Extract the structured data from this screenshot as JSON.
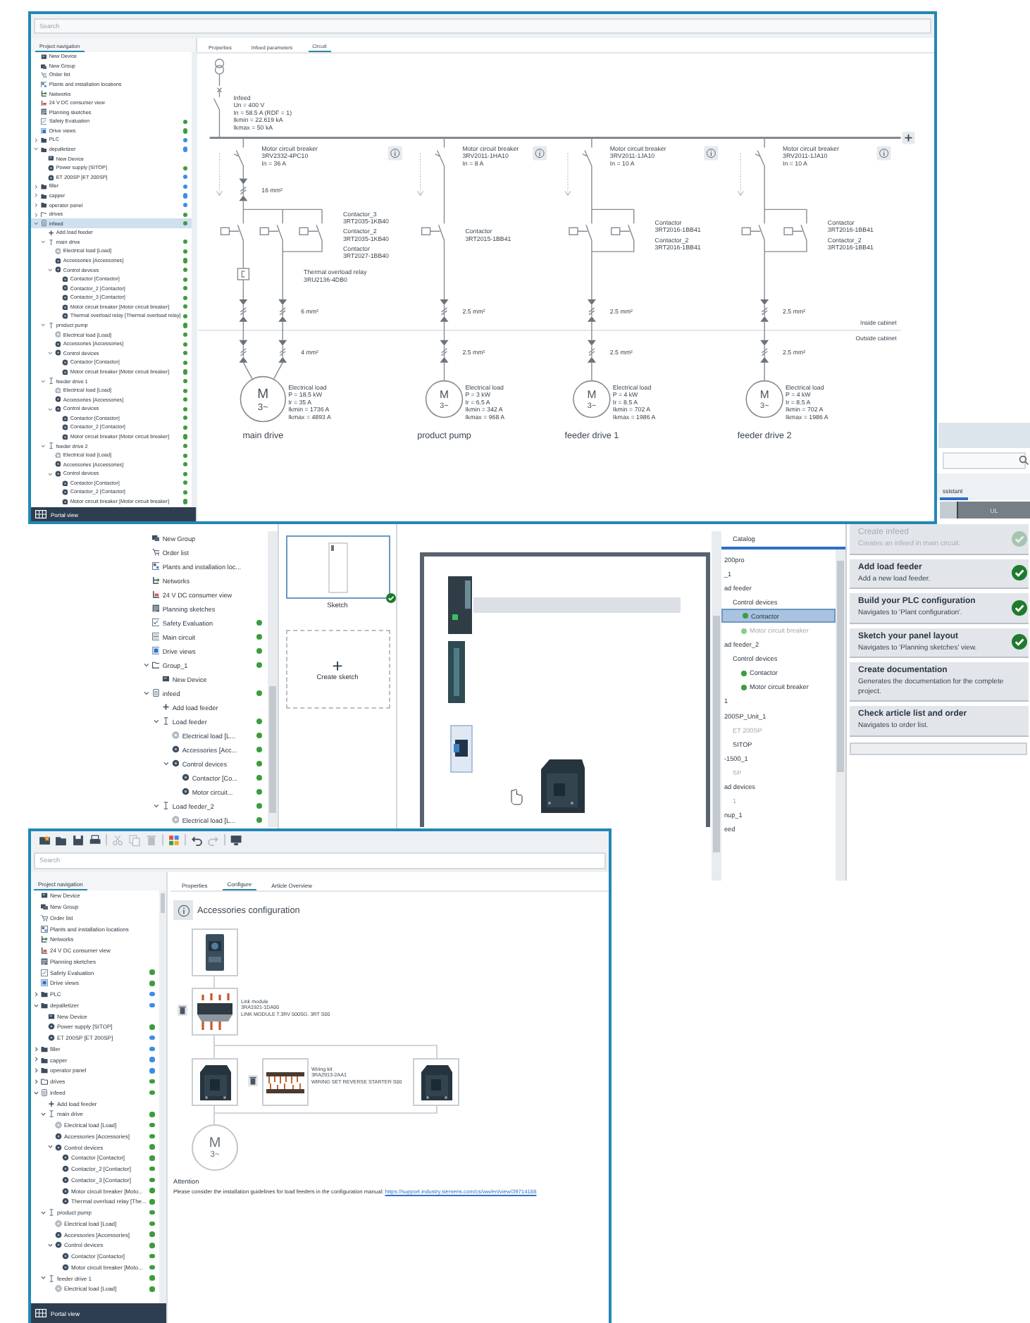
{
  "circuit_window": {
    "search_placeholder": "Search",
    "navigation_tab": "Project navigation",
    "tree": [
      {
        "label": "New Device",
        "kind": "device",
        "selected": false
      },
      {
        "label": "New Group",
        "kind": "devices",
        "selected": false
      },
      {
        "label": "Order list",
        "kind": "cart",
        "selected": false
      },
      {
        "label": "Plants and installation locations",
        "kind": "plan",
        "selected": false
      },
      {
        "label": "Networks",
        "kind": "network",
        "selected": false
      },
      {
        "label": "24 V DC consumer view",
        "kind": "power",
        "selected": false
      },
      {
        "label": "Planning sketches",
        "kind": "sketch",
        "selected": false
      },
      {
        "label": "Safety Evaluation",
        "kind": "checklist",
        "selected": false,
        "color": "#3d9c3d"
      },
      {
        "label": "Drive views",
        "kind": "screen",
        "selected": false,
        "color": "#3d9c3d"
      },
      {
        "label": "PLC",
        "kind": "folder",
        "selected": false,
        "color": "#3a8ee6",
        "expanded": false
      },
      {
        "label": "depalletizer",
        "kind": "folder",
        "selected": false,
        "color": "#3a8ee6",
        "expanded": true,
        "children": [
          {
            "label": "New Device",
            "kind": "device",
            "selected": false
          },
          {
            "label": "Power supply [SITOP]",
            "kind": "gear",
            "selected": false,
            "color": "#3d9c3d"
          },
          {
            "label": "ET 200SP [ET 200SP]",
            "kind": "gear",
            "selected": false,
            "color": "#3a8ee6"
          }
        ]
      },
      {
        "label": "filler",
        "kind": "folder",
        "selected": false,
        "color": "#3a8ee6",
        "expanded": false
      },
      {
        "label": "capper",
        "kind": "folder",
        "selected": false,
        "color": "#3a8ee6",
        "expanded": false
      },
      {
        "label": "operator panel",
        "kind": "folder",
        "selected": false,
        "color": "#3a8ee6",
        "expanded": false
      },
      {
        "label": "drives",
        "kind": "folder-outline",
        "selected": false,
        "color": "#3d9c3d",
        "expanded": false
      },
      {
        "label": "infeed",
        "kind": "cabinet",
        "selected": true,
        "color": "#3d9c3d",
        "expanded": true,
        "children": [
          {
            "label": "Add load feeder",
            "kind": "plus",
            "selected": false
          },
          {
            "label": "main drive",
            "kind": "feeder",
            "selected": false,
            "color": "#3d9c3d",
            "expanded": true,
            "children": [
              {
                "label": "Electrical load [Load]",
                "kind": "ring",
                "selected": false,
                "color": "#3d9c3d"
              },
              {
                "label": "Accessories [Accessories]",
                "kind": "gear",
                "selected": false,
                "color": "#3d9c3d"
              },
              {
                "label": "Control devices",
                "kind": "gear",
                "selected": false,
                "color": "#3d9c3d",
                "expanded": true,
                "children": [
                  {
                    "label": "Contactor [Contactor]",
                    "kind": "gear",
                    "selected": false,
                    "color": "#3d9c3d"
                  },
                  {
                    "label": "Contactor_2 [Contactor]",
                    "kind": "gear",
                    "selected": false,
                    "color": "#3d9c3d"
                  },
                  {
                    "label": "Contactor_3 [Contactor]",
                    "kind": "gear",
                    "selected": false,
                    "color": "#3d9c3d"
                  },
                  {
                    "label": "Motor circuit breaker [Motor circuit breaker]",
                    "kind": "gear",
                    "selected": false,
                    "color": "#3d9c3d"
                  },
                  {
                    "label": "Thermal overload relay [Thermal overload relay]",
                    "kind": "gear",
                    "selected": false,
                    "color": "#3d9c3d"
                  }
                ]
              }
            ]
          },
          {
            "label": "product pump",
            "kind": "feeder",
            "selected": false,
            "color": "#3d9c3d",
            "expanded": true,
            "children": [
              {
                "label": "Electrical load [Load]",
                "kind": "ring",
                "selected": false,
                "color": "#3d9c3d"
              },
              {
                "label": "Accessories [Accessories]",
                "kind": "gear",
                "selected": false,
                "color": "#3d9c3d"
              },
              {
                "label": "Control devices",
                "kind": "gear",
                "selected": false,
                "color": "#3d9c3d",
                "expanded": true,
                "children": [
                  {
                    "label": "Contactor [Contactor]",
                    "kind": "gear",
                    "selected": false,
                    "color": "#3d9c3d"
                  },
                  {
                    "label": "Motor circuit breaker [Motor circuit breaker]",
                    "kind": "gear",
                    "selected": false,
                    "color": "#3d9c3d"
                  }
                ]
              }
            ]
          },
          {
            "label": "feeder drive 1",
            "kind": "feeder",
            "selected": false,
            "color": "#3d9c3d",
            "expanded": true,
            "children": [
              {
                "label": "Electrical load [Load]",
                "kind": "ring",
                "selected": false,
                "color": "#3d9c3d"
              },
              {
                "label": "Accessories [Accessories]",
                "kind": "gear",
                "selected": false,
                "color": "#3d9c3d"
              },
              {
                "label": "Control devices",
                "kind": "gear",
                "selected": false,
                "color": "#3d9c3d",
                "expanded": true,
                "children": [
                  {
                    "label": "Contactor [Contactor]",
                    "kind": "gear",
                    "selected": false,
                    "color": "#3d9c3d"
                  },
                  {
                    "label": "Contactor_2 [Contactor]",
                    "kind": "gear",
                    "selected": false,
                    "color": "#3d9c3d"
                  },
                  {
                    "label": "Motor circuit breaker [Motor circuit breaker]",
                    "kind": "gear",
                    "selected": false,
                    "color": "#3d9c3d"
                  }
                ]
              }
            ]
          },
          {
            "label": "feeder drive 2",
            "kind": "feeder",
            "selected": false,
            "color": "#3d9c3d",
            "expanded": true,
            "children": [
              {
                "label": "Electrical load [Load]",
                "kind": "ring",
                "selected": false,
                "color": "#3d9c3d"
              },
              {
                "label": "Accessories [Accessories]",
                "kind": "gear",
                "selected": false,
                "color": "#3d9c3d"
              },
              {
                "label": "Control devices",
                "kind": "gear",
                "selected": false,
                "color": "#3d9c3d",
                "expanded": true,
                "children": [
                  {
                    "label": "Contactor [Contactor]",
                    "kind": "gear",
                    "selected": false,
                    "color": "#3d9c3d"
                  },
                  {
                    "label": "Contactor_2 [Contactor]",
                    "kind": "gear",
                    "selected": false,
                    "color": "#3d9c3d"
                  },
                  {
                    "label": "Motor circuit breaker [Motor circuit breaker]",
                    "kind": "gear",
                    "selected": false,
                    "color": "#3d9c3d"
                  }
                ]
              }
            ]
          }
        ]
      }
    ],
    "portal_view": "Portal view",
    "tabs": [
      {
        "label": "Properties",
        "selected": false
      },
      {
        "label": "Infeed parameters",
        "selected": false
      },
      {
        "label": "Circuit",
        "selected": true
      }
    ],
    "infeed": [
      "Infeed",
      "Un = 400 V",
      "In = 58.5 A (RDF = 1)",
      "Ikmin = 22.619 kA",
      "Ikmax = 50 kA"
    ],
    "feeders": [
      {
        "name": "main drive",
        "breaker": [
          "Motor circuit breaker",
          "3RV2332-4PC10",
          "In = 36 A"
        ],
        "breaker_cable": "16 mm²",
        "contactors": [
          [
            "Contactor_3",
            "3RT2035-1KB40"
          ],
          [
            "Contactor_2",
            "3RT2035-1KB40"
          ],
          [
            "Contactor",
            "3RT2027-1BB40"
          ]
        ],
        "thermal_relay": [
          "Thermal overload relay",
          "3RU2136-4DB0"
        ],
        "cable_inside": "6 mm²",
        "cable_outside": "4 mm²",
        "motor": {
          "letter": "M",
          "phases": "3~"
        },
        "load": [
          "Electrical load",
          "P = 18.5 kW",
          "Ir = 35 A",
          "Ikmin = 1736 A",
          "Ikmax = 4893 A"
        ]
      },
      {
        "name": "product pump",
        "breaker": [
          "Motor circuit breaker",
          "3RV2011-1HA10",
          "In = 8 A"
        ],
        "contactors": [
          [
            "Contactor",
            "3RT2015-1BB41"
          ]
        ],
        "cable_inside": "2.5 mm²",
        "cable_outside": "2.5 mm²",
        "motor": {
          "letter": "M",
          "phases": "3~"
        },
        "load": [
          "Electrical load",
          "P = 3 kW",
          "Ir = 6.5 A",
          "Ikmin = 342 A",
          "Ikmax = 968 A"
        ]
      },
      {
        "name": "feeder drive 1",
        "breaker": [
          "Motor circuit breaker",
          "3RV2011-1JA10",
          "In = 10 A"
        ],
        "contactors": [
          [
            "Contactor",
            "3RT2016-1BB41"
          ],
          [
            "Contactor_2",
            "3RT2016-1BB41"
          ]
        ],
        "cable_inside": "2.5 mm²",
        "cable_outside": "2.5 mm²",
        "motor": {
          "letter": "M",
          "phases": "3~"
        },
        "load": [
          "Electrical load",
          "P = 4 kW",
          "Ir = 8.5 A",
          "Ikmin = 702 A",
          "Ikmax = 1986 A"
        ]
      },
      {
        "name": "feeder drive 2",
        "breaker": [
          "Motor circuit breaker",
          "3RV2011-1JA10",
          "In = 10 A"
        ],
        "contactors": [
          [
            "Contactor",
            "3RT2016-1BB41"
          ],
          [
            "Contactor_2",
            "3RT2016-1BB41"
          ]
        ],
        "cable_inside": "2.5 mm²",
        "cable_outside": "2.5 mm²",
        "motor": {
          "letter": "M",
          "phases": "3~"
        },
        "load": [
          "Electrical load",
          "P = 4 kW",
          "Ir = 8.5 A",
          "Ikmin = 702 A",
          "Ikmax = 1986 A"
        ]
      }
    ],
    "zones": [
      "Inside cabinet",
      "Outside cabinet"
    ]
  },
  "sketch_window": {
    "tree": [
      {
        "label": "New Group",
        "kind": "devices",
        "selected": false
      },
      {
        "label": "Order list",
        "kind": "cart",
        "selected": false
      },
      {
        "label": "Plants and installation loc...",
        "kind": "plan",
        "selected": false
      },
      {
        "label": "Networks",
        "kind": "network",
        "selected": false
      },
      {
        "label": "24 V DC consumer view",
        "kind": "power",
        "selected": false
      },
      {
        "label": "Planning sketches",
        "kind": "sketch",
        "selected": false
      },
      {
        "label": "Safety Evaluation",
        "kind": "checklist",
        "selected": false,
        "color": "#3d9c3d"
      },
      {
        "label": "Main circuit",
        "kind": "circuit",
        "selected": false,
        "color": "#3d9c3d"
      },
      {
        "label": "Drive views",
        "kind": "screen",
        "selected": false,
        "color": "#3d9c3d"
      },
      {
        "label": "Group_1",
        "kind": "folder-outline",
        "selected": false,
        "color": "#3d9c3d",
        "expanded": true,
        "children": [
          {
            "label": "New Device",
            "kind": "device",
            "selected": false
          }
        ]
      },
      {
        "label": "infeed",
        "kind": "cabinet",
        "selected": false,
        "color": "#3d9c3d",
        "expanded": true,
        "children": [
          {
            "label": "Add load feeder",
            "kind": "plus",
            "selected": false
          },
          {
            "label": "Load feeder",
            "kind": "feeder",
            "selected": false,
            "color": "#3d9c3d",
            "expanded": true,
            "children": [
              {
                "label": "Electrical load [L...",
                "kind": "ring",
                "selected": false,
                "color": "#3d9c3d"
              },
              {
                "label": "Accessories [Acc...",
                "kind": "gear",
                "selected": false,
                "color": "#3d9c3d"
              },
              {
                "label": "Control devices",
                "kind": "gear",
                "selected": false,
                "color": "#3d9c3d",
                "expanded": true,
                "children": [
                  {
                    "label": "Contactor [Co...",
                    "kind": "gear",
                    "selected": false,
                    "color": "#3d9c3d"
                  },
                  {
                    "label": "Motor circuit...",
                    "kind": "gear",
                    "selected": false,
                    "color": "#3d9c3d"
                  }
                ]
              }
            ]
          },
          {
            "label": "Load feeder_2",
            "kind": "feeder",
            "selected": false,
            "color": "#3d9c3d",
            "expanded": true,
            "children": [
              {
                "label": "Electrical load [L...",
                "kind": "ring",
                "selected": false,
                "color": "#3d9c3d"
              }
            ]
          }
        ]
      }
    ],
    "sketches": [
      {
        "label": "Sketch",
        "done": true,
        "selected": true
      }
    ],
    "create_sketch": {
      "plus": "+",
      "label": "Create sketch"
    },
    "catalog_tab": {
      "label": "Catalog",
      "selected": true
    },
    "catalog": [
      {
        "label": "200pro",
        "selected": false,
        "disabled": false
      },
      {
        "label": "_1",
        "selected": false,
        "disabled": false
      },
      {
        "label": "ad feeder",
        "selected": false,
        "disabled": false,
        "children": [
          {
            "label": "Control devices",
            "selected": false,
            "disabled": false,
            "children": [
              {
                "label": "Contactor",
                "selected": true,
                "disabled": false,
                "color": "#3d9c3d"
              },
              {
                "label": "Motor circuit breaker",
                "selected": false,
                "disabled": true,
                "color": "#8fc98f"
              }
            ]
          }
        ]
      },
      {
        "label": "ad feeder_2",
        "selected": false,
        "disabled": false,
        "children": [
          {
            "label": "Control devices",
            "selected": false,
            "disabled": false,
            "children": [
              {
                "label": "Contactor",
                "selected": false,
                "disabled": false,
                "color": "#3d9c3d"
              },
              {
                "label": "Motor circuit breaker",
                "selected": false,
                "disabled": false,
                "color": "#3d9c3d"
              }
            ]
          }
        ]
      },
      {
        "label": "1",
        "selected": false,
        "disabled": false
      },
      {
        "label": "200SP_Unit_1",
        "selected": false,
        "disabled": false,
        "children": [
          {
            "label": "ET 200SP",
            "selected": false,
            "disabled": true
          },
          {
            "label": "SITOP",
            "selected": false,
            "disabled": false
          }
        ]
      },
      {
        "label": "-1500_1",
        "selected": false,
        "disabled": false,
        "children": [
          {
            "label": "SP",
            "selected": false,
            "disabled": true
          }
        ]
      },
      {
        "label": "ad devices",
        "selected": false,
        "disabled": false,
        "children": [
          {
            "label": "1",
            "selected": false,
            "disabled": true
          }
        ]
      },
      {
        "label": "nup_1",
        "selected": false,
        "disabled": false
      },
      {
        "label": "eed",
        "selected": false,
        "disabled": false
      }
    ],
    "assistant_tab": {
      "label": "ssistant",
      "selected": true
    },
    "norm_segment": "UL",
    "assistant_steps": [
      {
        "title": "Create infeed",
        "description": "Creates an infeed in main circuit.",
        "done": true,
        "enabled": false
      },
      {
        "title": "Add load feeder",
        "description": "Add a new load feeder.",
        "done": true,
        "enabled": true
      },
      {
        "title": "Build your PLC configuration",
        "description": "Navigates to 'Plant configuration'.",
        "done": true,
        "enabled": true
      },
      {
        "title": "Sketch your panel layout",
        "description": "Navigates to 'Planning sketches' view.",
        "done": true,
        "enabled": true
      },
      {
        "title": "Create documentation",
        "description": "Generates the documentation for the complete project.",
        "done": false,
        "enabled": true
      },
      {
        "title": "Check article list and order",
        "description": "Navigates to order list.",
        "done": false,
        "enabled": true
      }
    ]
  },
  "config_window": {
    "toolbar": [
      {
        "kind": "new",
        "disabled": false
      },
      {
        "kind": "open",
        "disabled": false
      },
      {
        "kind": "save",
        "disabled": false
      },
      {
        "kind": "print",
        "disabled": false
      },
      {
        "kind": "cut",
        "disabled": true
      },
      {
        "kind": "copy",
        "disabled": true
      },
      {
        "kind": "delete",
        "disabled": true
      },
      {
        "kind": "apps",
        "disabled": false
      },
      {
        "kind": "undo",
        "disabled": false
      },
      {
        "kind": "redo",
        "disabled": true
      },
      {
        "kind": "monitor",
        "disabled": false
      }
    ],
    "search_placeholder": "Search",
    "navigation_tab": "Project navigation",
    "tree": [
      {
        "label": "New Device",
        "kind": "device",
        "selected": false
      },
      {
        "label": "New Group",
        "kind": "devices",
        "selected": false
      },
      {
        "label": "Order list",
        "kind": "cart",
        "selected": false
      },
      {
        "label": "Plants and installation locations",
        "kind": "plan",
        "selected": false
      },
      {
        "label": "Networks",
        "kind": "network",
        "selected": false
      },
      {
        "label": "24 V DC consumer view",
        "kind": "power",
        "selected": false
      },
      {
        "label": "Planning sketches",
        "kind": "sketch",
        "selected": false
      },
      {
        "label": "Safety Evaluation",
        "kind": "checklist",
        "selected": false,
        "color": "#3d9c3d"
      },
      {
        "label": "Drive views",
        "kind": "screen",
        "selected": false,
        "color": "#3d9c3d"
      },
      {
        "label": "PLC",
        "kind": "folder",
        "selected": false,
        "color": "#3a8ee6",
        "expanded": false
      },
      {
        "label": "depalletizer",
        "kind": "folder",
        "selected": false,
        "color": "#3a8ee6",
        "expanded": true,
        "children": [
          {
            "label": "New Device",
            "kind": "device",
            "selected": false
          },
          {
            "label": "Power supply [SITOP]",
            "kind": "gear",
            "selected": false,
            "color": "#3d9c3d"
          },
          {
            "label": "ET 200SP [ET 200SP]",
            "kind": "gear",
            "selected": false,
            "color": "#3a8ee6"
          }
        ]
      },
      {
        "label": "filler",
        "kind": "folder",
        "selected": false,
        "color": "#3a8ee6",
        "expanded": false
      },
      {
        "label": "capper",
        "kind": "folder",
        "selected": false,
        "color": "#3a8ee6",
        "expanded": false
      },
      {
        "label": "operator panel",
        "kind": "folder",
        "selected": false,
        "color": "#3a8ee6",
        "expanded": false
      },
      {
        "label": "drives",
        "kind": "folder-outline",
        "selected": false,
        "color": "#3d9c3d",
        "expanded": false
      },
      {
        "label": "infeed",
        "kind": "cabinet",
        "selected": false,
        "color": "#3d9c3d",
        "expanded": true,
        "children": [
          {
            "label": "Add load feeder",
            "kind": "plus",
            "selected": false
          },
          {
            "label": "main drive",
            "kind": "feeder",
            "selected": false,
            "color": "#3d9c3d",
            "expanded": true,
            "children": [
              {
                "label": "Electrical load [Load]",
                "kind": "ring",
                "selected": false,
                "color": "#3d9c3d"
              },
              {
                "label": "Accessories [Accessories]",
                "kind": "gear",
                "selected": false,
                "color": "#3d9c3d"
              },
              {
                "label": "Control devices",
                "kind": "gear",
                "selected": false,
                "color": "#3d9c3d",
                "expanded": true,
                "children": [
                  {
                    "label": "Contactor [Contactor]",
                    "kind": "gear",
                    "selected": false,
                    "color": "#3d9c3d"
                  },
                  {
                    "label": "Contactor_2 [Contactor]",
                    "kind": "gear",
                    "selected": false,
                    "color": "#3d9c3d"
                  },
                  {
                    "label": "Contactor_3 [Contactor]",
                    "kind": "gear",
                    "selected": false,
                    "color": "#3d9c3d"
                  },
                  {
                    "label": "Motor circuit breaker [Moto...",
                    "kind": "gear",
                    "selected": false,
                    "color": "#3d9c3d"
                  },
                  {
                    "label": "Thermal overload relay [The...",
                    "kind": "gear",
                    "selected": false,
                    "color": "#3d9c3d"
                  }
                ]
              }
            ]
          },
          {
            "label": "product pump",
            "kind": "feeder",
            "selected": false,
            "color": "#3d9c3d",
            "expanded": true,
            "children": [
              {
                "label": "Electrical load [Load]",
                "kind": "ring",
                "selected": false,
                "color": "#3d9c3d"
              },
              {
                "label": "Accessories [Accessories]",
                "kind": "gear",
                "selected": false,
                "color": "#3d9c3d"
              },
              {
                "label": "Control devices",
                "kind": "gear",
                "selected": false,
                "color": "#3d9c3d",
                "expanded": true,
                "children": [
                  {
                    "label": "Contactor [Contactor]",
                    "kind": "gear",
                    "selected": false,
                    "color": "#3d9c3d"
                  },
                  {
                    "label": "Motor circuit breaker [Moto...",
                    "kind": "gear",
                    "selected": false,
                    "color": "#3d9c3d"
                  }
                ]
              }
            ]
          },
          {
            "label": "feeder drive 1",
            "kind": "feeder",
            "selected": false,
            "color": "#3d9c3d",
            "expanded": true,
            "children": [
              {
                "label": "Electrical load [Load]",
                "kind": "ring",
                "selected": false,
                "color": "#3d9c3d"
              }
            ]
          }
        ]
      }
    ],
    "portal_view": "Portal view",
    "tabs": [
      {
        "label": "Properties",
        "selected": false
      },
      {
        "label": "Configure",
        "selected": true
      },
      {
        "label": "Article Overview",
        "selected": false
      }
    ],
    "heading": "Accessories configuration",
    "components": [
      {
        "kind": "breaker",
        "removable": false
      },
      {
        "kind": "link_module",
        "removable": true,
        "label": [
          "Link module",
          "3RA1921-1DA00",
          "LINK MODULE T.3RV 500SG. 3RT S00"
        ]
      },
      {
        "kind": "contactor",
        "removable": false
      },
      {
        "kind": "wiring_kit",
        "removable": true,
        "label": [
          "Wiring kit",
          "3RA2913-2AA1",
          "WIRING SET REVERSE STARTER S00"
        ]
      },
      {
        "kind": "contactor",
        "removable": false
      },
      {
        "kind": "motor",
        "removable": false,
        "letter": "M",
        "phases": "3~"
      }
    ],
    "attention": {
      "title": "Attention",
      "note": "Please consider the installation guidelines for load feeders in the configuration manual: ",
      "link": "https://support.industry.siemens.com/cs/ww/en/view/39714188"
    }
  }
}
